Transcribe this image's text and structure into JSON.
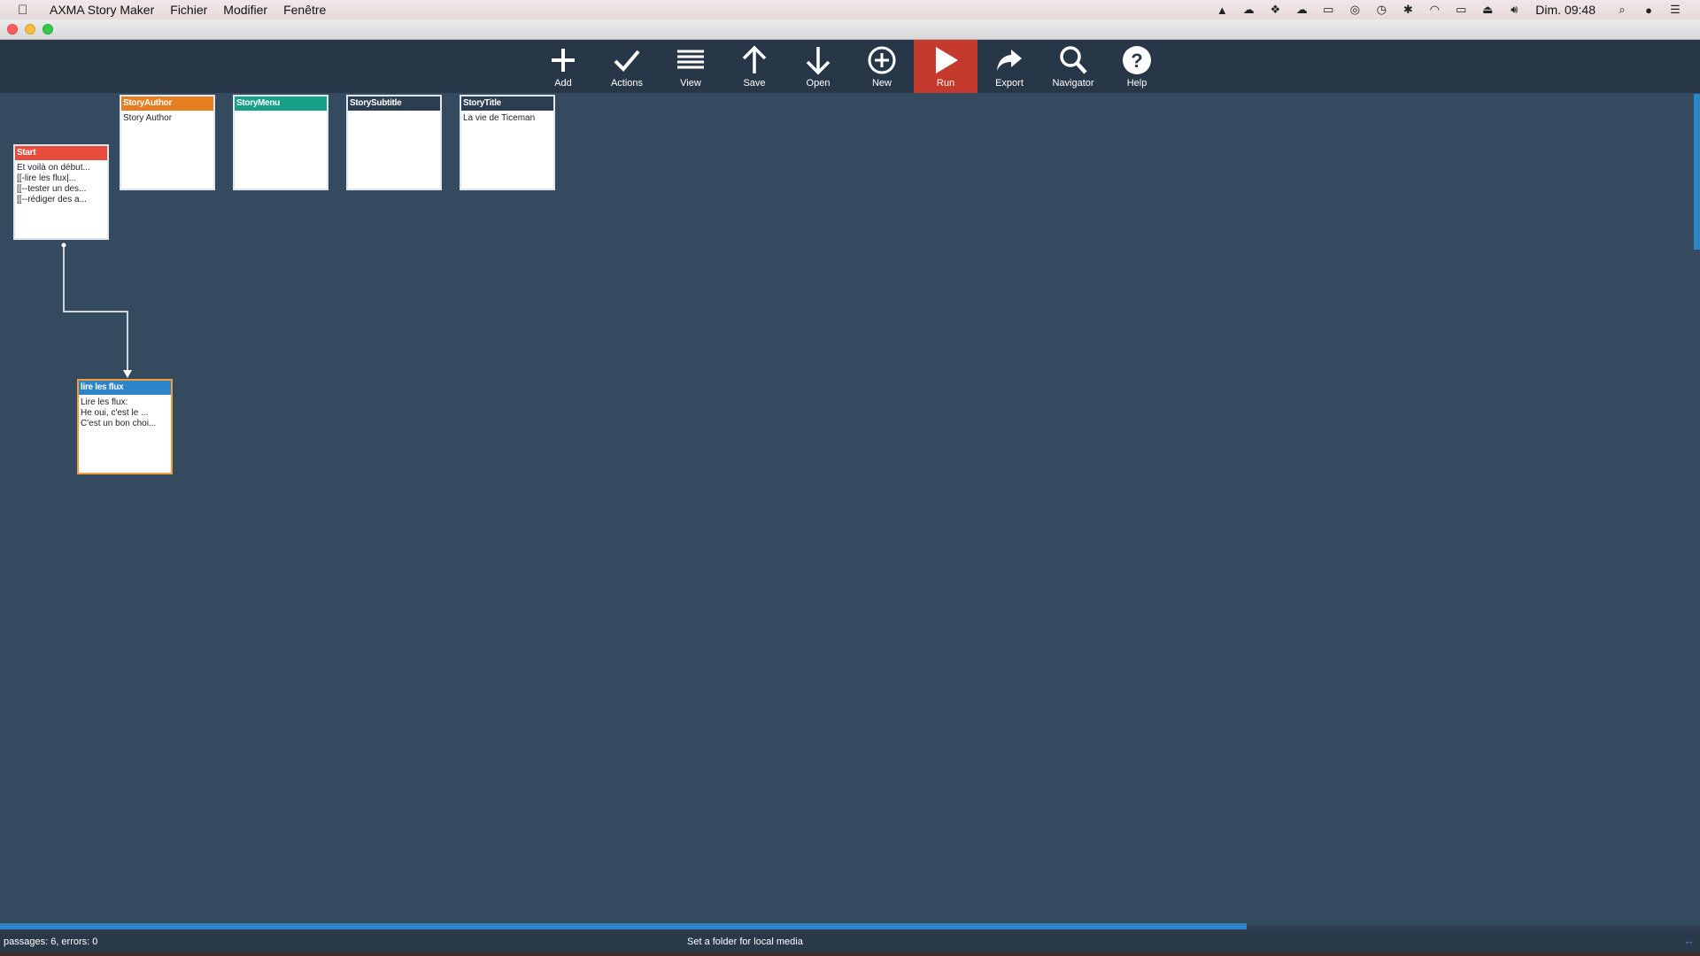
{
  "menubar": {
    "app_name": "AXMA Story Maker",
    "menus": [
      "Fichier",
      "Modifier",
      "Fenêtre"
    ],
    "clock": "Dim. 09:48"
  },
  "toolbar": {
    "add": "Add",
    "actions": "Actions",
    "view": "View",
    "save": "Save",
    "open": "Open",
    "new": "New",
    "run": "Run",
    "export": "Export",
    "navigator": "Navigator",
    "help": "Help"
  },
  "passages": {
    "start": {
      "title": "Start",
      "lines": [
        "Et voilà on début...",
        "[[-lire les flux|...",
        "[[--tester un des...",
        "[[--rédiger des a..."
      ],
      "color": "#e74c3c"
    },
    "story_author": {
      "title": "StoryAuthor",
      "lines": [
        "Story Author"
      ],
      "color": "#e67e22"
    },
    "story_menu": {
      "title": "StoryMenu",
      "lines": [
        ""
      ],
      "color": "#16a085"
    },
    "story_subtitle": {
      "title": "StorySubtitle",
      "lines": [
        ""
      ],
      "color": "#2c3e50"
    },
    "story_title": {
      "title": "StoryTitle",
      "lines": [
        "La vie de Ticeman"
      ],
      "color": "#2c3e50"
    },
    "lire_les_flux": {
      "title": "lire les flux",
      "lines": [
        "Lire les flux:",
        "He oui, c'est le ...",
        "C'est un bon choi..."
      ],
      "color": "#2d84c9"
    }
  },
  "statusbar": {
    "info": "passages: 6, errors: 0",
    "media_hint": "Set a folder for local media",
    "corner_icon": "resize-arrows-icon"
  },
  "colors": {
    "canvas": "#344a5f",
    "toolbar": "#283748",
    "run_active": "#c63a2d",
    "accent": "#2d84c9"
  }
}
